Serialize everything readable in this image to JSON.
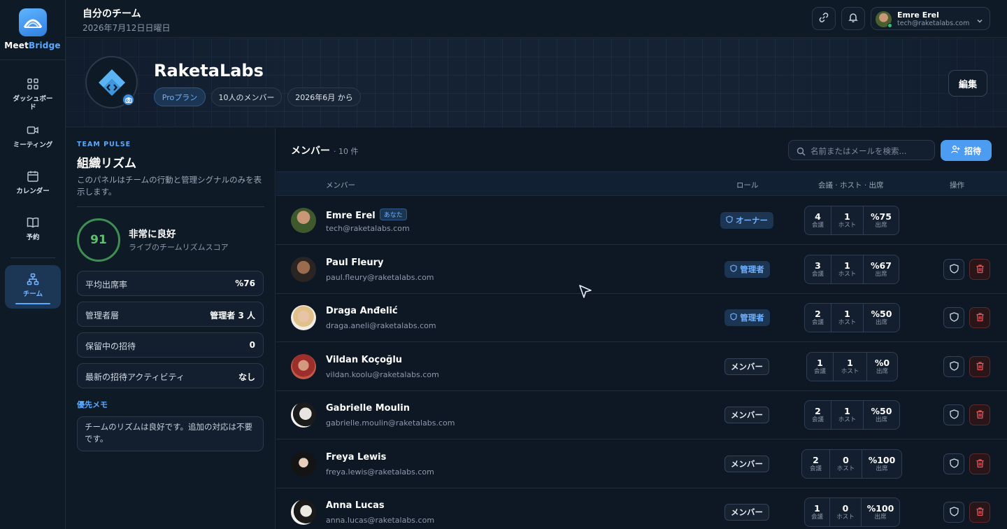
{
  "app": {
    "brand_part1": "Meet",
    "brand_part2": "Bridge"
  },
  "sidebar": {
    "items": [
      {
        "label": "ダッシュボード",
        "icon": "grid-icon"
      },
      {
        "label": "ミーティング",
        "icon": "video-icon"
      },
      {
        "label": "カレンダー",
        "icon": "calendar-icon"
      },
      {
        "label": "予約",
        "icon": "book-icon"
      },
      {
        "label": "チーム",
        "icon": "team-tree-icon",
        "active": true
      }
    ]
  },
  "header": {
    "title": "自分のチーム",
    "date": "2026年7月12日日曜日",
    "user_name": "Emre Erel",
    "user_email": "tech@raketalabs.com"
  },
  "banner": {
    "team_name": "RaketaLabs",
    "chips": [
      "Proプラン",
      "10人のメンバー",
      "2026年6月 から"
    ],
    "edit_label": "編集"
  },
  "pulse": {
    "kicker": "TEAM PULSE",
    "title": "組織リズム",
    "description": "このパネルはチームの行動と管理シグナルのみを表示します。",
    "score": "91",
    "score_label": "非常に良好",
    "score_sub": "ライブのチームリズムスコア",
    "stats": [
      {
        "key": "平均出席率",
        "value": "%76"
      },
      {
        "key": "管理者層",
        "value": "管理者 3 人"
      },
      {
        "key": "保留中の招待",
        "value": "0"
      },
      {
        "key": "最新の招待アクティビティ",
        "value": "なし"
      }
    ],
    "memo_title": "優先メモ",
    "memo": "チームのリズムは良好です。追加の対応は不要です。"
  },
  "members": {
    "title": "メンバー",
    "count": "· 10 件",
    "search_placeholder": "名前またはメールを検索...",
    "invite_label": "招待",
    "columns": {
      "member": "メンバー",
      "role": "ロール",
      "stats": "会議 · ホスト · 出席",
      "actions": "操作"
    },
    "stat_labels": {
      "meetings": "会議",
      "host": "ホスト",
      "attendance": "出席"
    },
    "you_badge": "あなた",
    "rows": [
      {
        "name": "Emre Erel",
        "email": "tech@raketalabs.com",
        "role": "オーナー",
        "meetings": "4",
        "host": "1",
        "attendance": "%75",
        "you": true
      },
      {
        "name": "Paul Fleury",
        "email": "paul.fleury@raketalabs.com",
        "role": "管理者",
        "meetings": "3",
        "host": "1",
        "attendance": "%67"
      },
      {
        "name": "Draga Anđelić",
        "email": "draga.aneli@raketalabs.com",
        "role": "管理者",
        "meetings": "2",
        "host": "1",
        "attendance": "%50"
      },
      {
        "name": "Vildan Koçoğlu",
        "email": "vildan.koolu@raketalabs.com",
        "role": "メンバー",
        "meetings": "1",
        "host": "1",
        "attendance": "%0"
      },
      {
        "name": "Gabrielle Moulin",
        "email": "gabrielle.moulin@raketalabs.com",
        "role": "メンバー",
        "meetings": "2",
        "host": "1",
        "attendance": "%50"
      },
      {
        "name": "Freya Lewis",
        "email": "freya.lewis@raketalabs.com",
        "role": "メンバー",
        "meetings": "2",
        "host": "0",
        "attendance": "%100"
      },
      {
        "name": "Anna Lucas",
        "email": "anna.lucas@raketalabs.com",
        "role": "メンバー",
        "meetings": "1",
        "host": "0",
        "attendance": "%100"
      }
    ]
  },
  "colors": {
    "accent": "#4c9df2",
    "success": "#5fc06f",
    "danger": "#e0575f"
  }
}
